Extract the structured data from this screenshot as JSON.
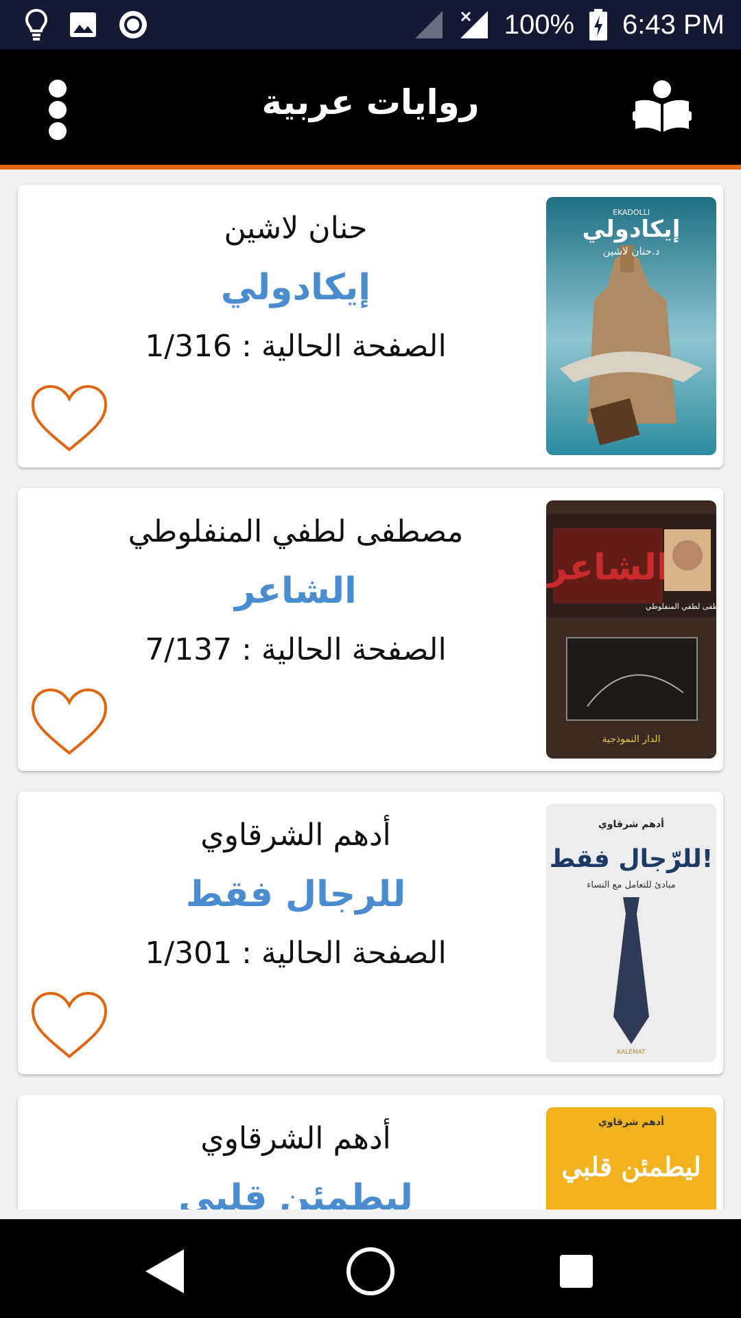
{
  "status_bar": {
    "battery": "100%",
    "time": "6:43 PM",
    "icons": [
      "lightbulb-icon",
      "image-icon",
      "record-icon",
      "signal-icon",
      "no-signal-icon",
      "battery-charging-icon"
    ]
  },
  "app_bar": {
    "title": "روايات عربية",
    "menu_icon": "more-vert-icon",
    "reader_icon": "reading-icon"
  },
  "colors": {
    "accent": "#e0650f",
    "title_blue": "#4a8cd0",
    "appbar": "#000000",
    "statusbar": "#141a33"
  },
  "books": [
    {
      "author": "حنان لاشين",
      "title": "إيكادولي",
      "page_label": "الصفحة الحالية :",
      "page_value": "1/316",
      "cover_title": "إيكادولي",
      "cover_author": "د.حنان لاشين",
      "cover_top": "EKADOLLI",
      "favorite": false
    },
    {
      "author": "مصطفى لطفي المنفلوطي",
      "title": "الشاعر",
      "page_label": "الصفحة الحالية :",
      "page_value": "7/137",
      "cover_title": "الشاعر",
      "cover_author": "مصطفى لطفي المنفلوطي",
      "cover_publisher": "الدار النموذجية",
      "favorite": false
    },
    {
      "author": "أدهم الشرقاوي",
      "title": "للرجال فقط",
      "page_label": "الصفحة الحالية :",
      "page_value": "1/301",
      "cover_title": "للرّجال فقط!",
      "cover_author": "أدهم شرقاوي",
      "cover_subtitle": "مبادئ للتعامل مع النساء",
      "cover_publisher": "KALEMAT",
      "favorite": false
    },
    {
      "author": "أدهم الشرقاوي",
      "title": "ليطمئن قلبي",
      "cover_title": "ليطمئن قلبي",
      "cover_author": "أدهم شرقاوي"
    }
  ],
  "nav_bar": {
    "back": "back-icon",
    "home": "home-icon",
    "recents": "recents-icon"
  }
}
